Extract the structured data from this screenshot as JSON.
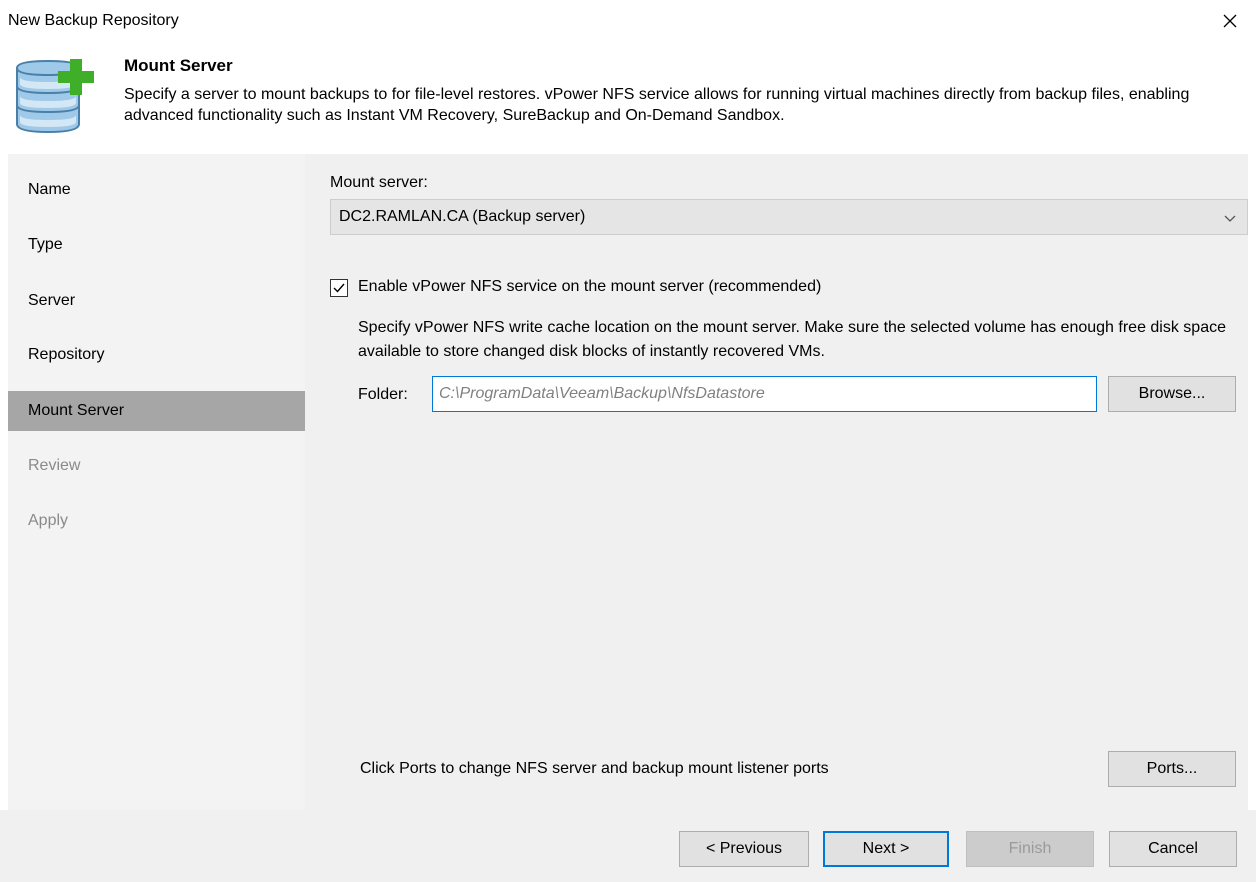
{
  "window": {
    "title": "New Backup Repository"
  },
  "header": {
    "title": "Mount Server",
    "description": "Specify a server to mount backups to for file-level restores. vPower NFS service allows for running virtual machines directly from backup files, enabling advanced functionality such as Instant VM Recovery, SureBackup and On-Demand Sandbox."
  },
  "sidebar": {
    "items": [
      {
        "label": "Name",
        "state": "normal"
      },
      {
        "label": "Type",
        "state": "normal"
      },
      {
        "label": "Server",
        "state": "normal"
      },
      {
        "label": "Repository",
        "state": "normal"
      },
      {
        "label": "Mount Server",
        "state": "active"
      },
      {
        "label": "Review",
        "state": "disabled"
      },
      {
        "label": "Apply",
        "state": "disabled"
      }
    ]
  },
  "main": {
    "mount_server_label": "Mount server:",
    "mount_server_value": "DC2.RAMLAN.CA (Backup server)",
    "nfs_checkbox_label": "Enable vPower NFS service on the mount server (recommended)",
    "nfs_checkbox_checked": true,
    "nfs_description": "Specify vPower NFS write cache location on the mount server. Make sure the selected volume has enough free disk space available to store changed disk blocks of instantly recovered VMs.",
    "folder_label": "Folder:",
    "folder_value": "C:\\ProgramData\\Veeam\\Backup\\NfsDatastore",
    "browse_label": "Browse...",
    "ports_hint": "Click Ports to change NFS server and backup mount listener ports",
    "ports_label": "Ports..."
  },
  "footer": {
    "previous_label": "< Previous",
    "next_label": "Next >",
    "finish_label": "Finish",
    "cancel_label": "Cancel"
  },
  "colors": {
    "accent": "#0078d7",
    "active_step": "#a6a6a6",
    "icon_green": "#3fae29",
    "icon_blue": "#9ec9e8"
  }
}
